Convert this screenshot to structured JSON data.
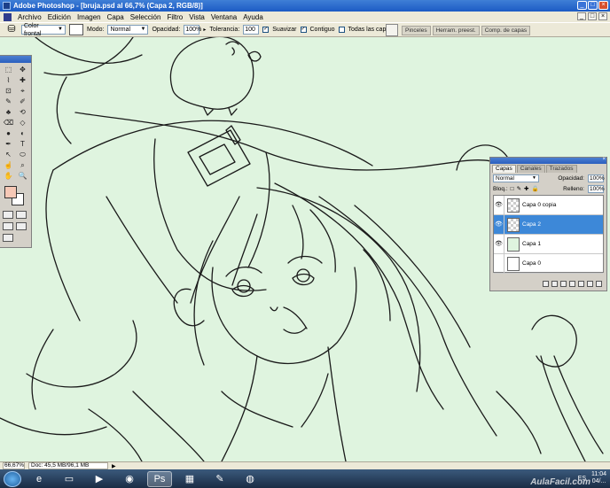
{
  "window": {
    "title": "Adobe Photoshop - [bruja.psd al 66,7% (Capa 2, RGB/8)]",
    "controls": [
      "_",
      "□",
      "×"
    ]
  },
  "menu": {
    "items": [
      "Archivo",
      "Edición",
      "Imagen",
      "Capa",
      "Selección",
      "Filtro",
      "Vista",
      "Ventana",
      "Ayuda"
    ],
    "doc_controls": [
      "_",
      "□",
      "×"
    ]
  },
  "options": {
    "tool_icon": "paint-bucket-icon",
    "fill_source": "Color frontal",
    "mode_label": "Modo:",
    "mode_value": "Normal",
    "opacity_label": "Opacidad:",
    "opacity_value": "100%",
    "tolerance_label": "Tolerancia:",
    "tolerance_value": "100",
    "antialias_label": "Suavizar",
    "contiguous_label": "Contiguo",
    "all_layers_label": "Todas las capas",
    "antialias_checked": true,
    "contiguous_checked": true,
    "all_layers_checked": false,
    "palette_tabs": [
      "Pinceles",
      "Herram. preest.",
      "Comp. de capas"
    ]
  },
  "toolbox": {
    "fg_color": "#f6c8b6",
    "bg_color": "#ffffff",
    "tools": [
      "⬚",
      "✥",
      "⌇",
      "✚",
      "⊡",
      "⌖",
      "✎",
      "✐",
      "♣",
      "⟲",
      "⌫",
      "◇",
      "●",
      "◐",
      "✒",
      "T",
      "↖",
      "⬭",
      "☝",
      "⌕",
      "✋",
      "🔍"
    ]
  },
  "layers_panel": {
    "tabs": [
      "Capas",
      "Canales",
      "Trazados"
    ],
    "active_tab": "Capas",
    "blend_mode": "Normal",
    "opacity_label": "Opacidad:",
    "opacity_value": "100%",
    "lock_label": "Bloq.:",
    "fill_label": "Relleno:",
    "fill_value": "100%",
    "layers": [
      {
        "name": "Capa 0 copia",
        "visible": true,
        "selected": false,
        "thumb": "transparent"
      },
      {
        "name": "Capa 2",
        "visible": true,
        "selected": true,
        "thumb": "transparent"
      },
      {
        "name": "Capa 1",
        "visible": true,
        "selected": false,
        "thumb": "filled"
      },
      {
        "name": "Capa 0",
        "visible": false,
        "selected": false,
        "thumb": "white"
      }
    ]
  },
  "status": {
    "zoom": "66,67%",
    "doc_info": "Doc: 45,5 MB/96,1 MB"
  },
  "taskbar": {
    "language": "ES",
    "time": "11:04",
    "date": "04/...",
    "watermark": "AulaFacil.com"
  },
  "colors": {
    "canvas_bg": "#dff4df",
    "accent": "#3d88d8"
  }
}
